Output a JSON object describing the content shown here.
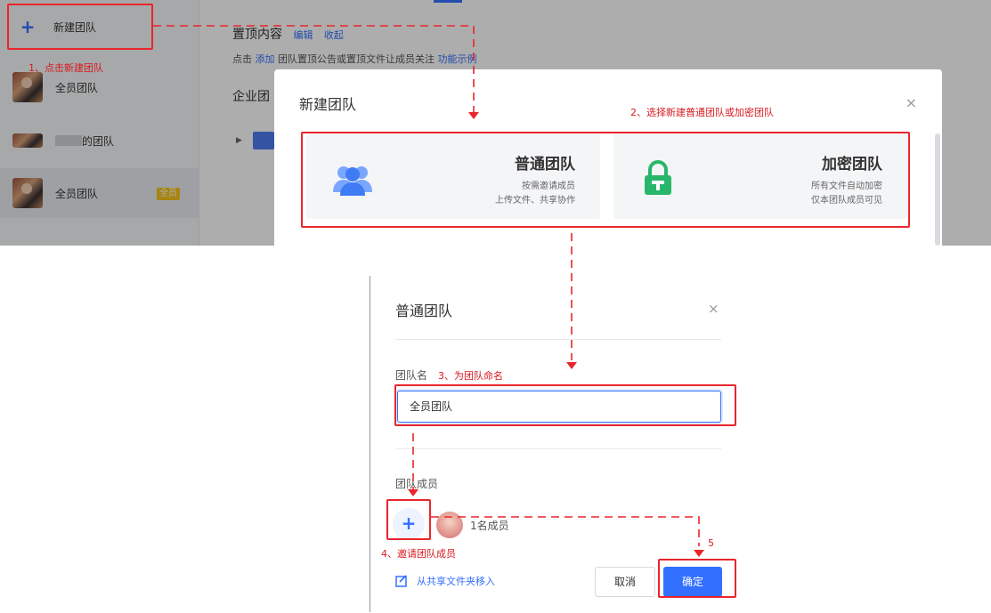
{
  "sidebar": {
    "new_team_label": "新建团队",
    "teams": [
      {
        "name": "全员团队"
      },
      {
        "name": "的团队"
      },
      {
        "name": "全员团队",
        "badge": "全员"
      }
    ]
  },
  "main": {
    "pin_title": "置顶内容",
    "pin_edit": "编辑",
    "pin_collapse": "收起",
    "pin_desc_prefix": "点击",
    "pin_desc_add": "添加",
    "pin_desc_mid": "团队置顶公告或置顶文件让成员关注",
    "pin_desc_example": "功能示例",
    "enterprise_label": "企业团"
  },
  "new_team_dialog": {
    "title": "新建团队",
    "close_icon": "×",
    "options": [
      {
        "title": "普通团队",
        "line1": "按需邀请成员",
        "line2": "上传文件、共享协作",
        "icon": "users-icon",
        "color": "#3f7bf5"
      },
      {
        "title": "加密团队",
        "line1": "所有文件自动加密",
        "line2": "仅本团队成员可见",
        "icon": "lock-icon",
        "color": "#28b76a"
      }
    ]
  },
  "normal_team_dialog": {
    "title": "普通团队",
    "close_icon": "×",
    "team_name_label": "团队名",
    "team_name_value": "全员团队",
    "members_label": "团队成员",
    "member_count": "1名成员",
    "move_from_shared": "从共享文件夹移入",
    "cancel_label": "取消",
    "confirm_label": "确定"
  },
  "annotations": {
    "step1": "1、点击新建团队",
    "step2": "2、选择新建普通团队或加密团队",
    "step3": "3、为团队命名",
    "step4": "4、邀请团队成员",
    "step5": "5",
    "color": "#e8262c"
  }
}
